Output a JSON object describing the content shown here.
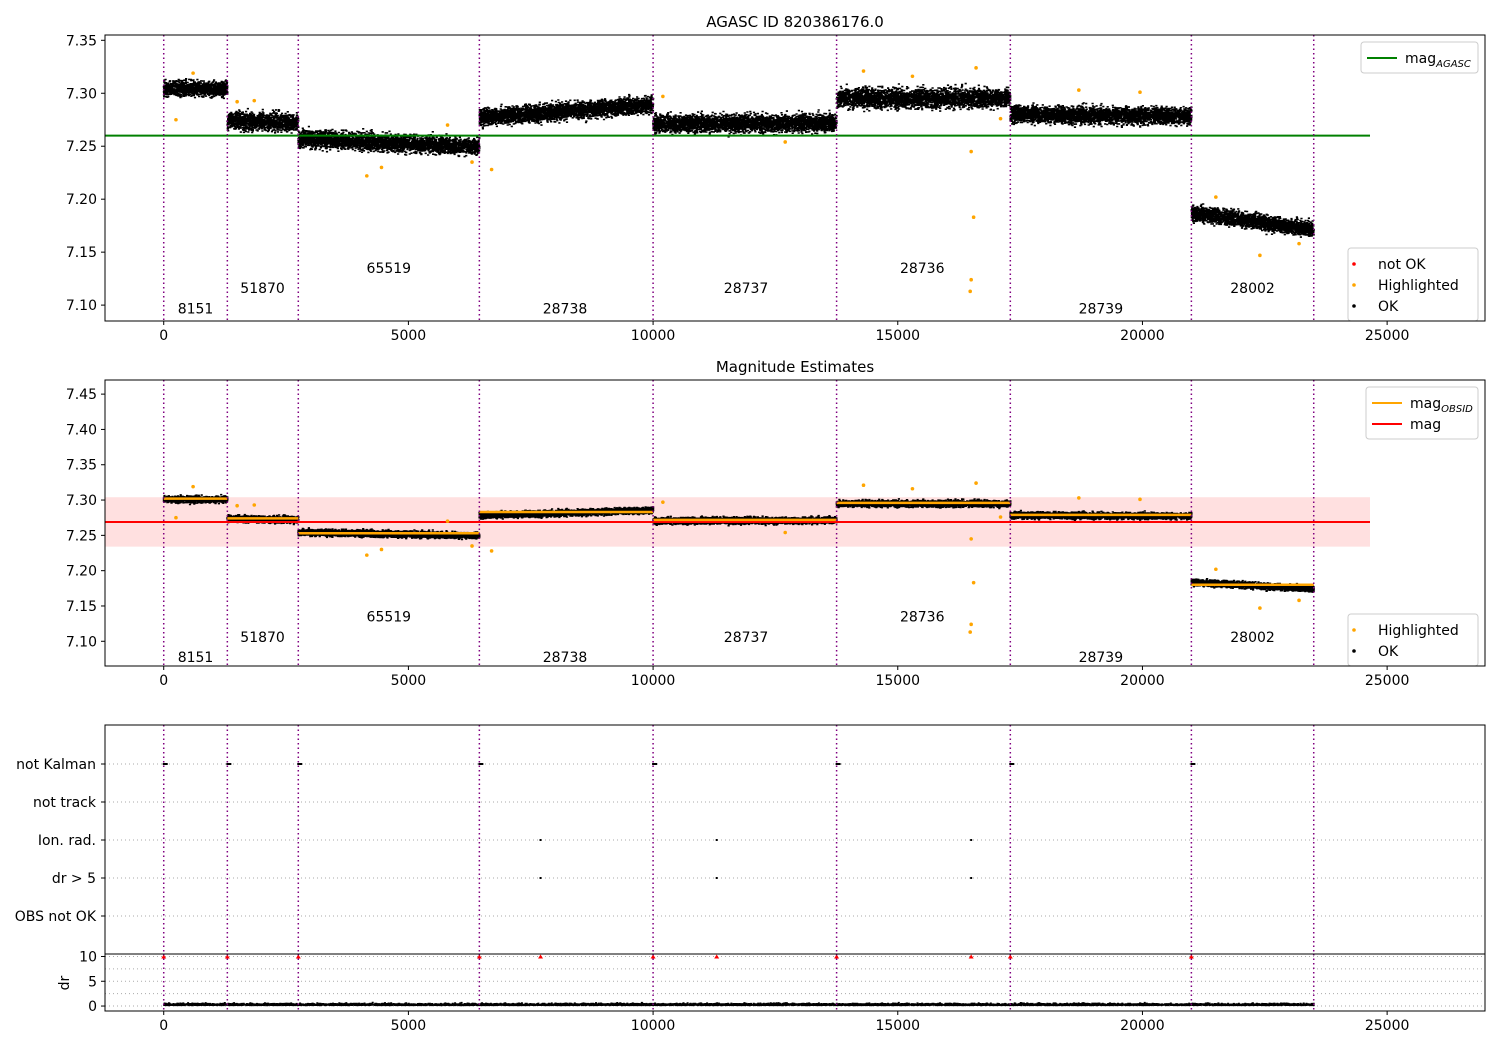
{
  "chart_data": [
    {
      "type": "scatter",
      "title": "AGASC ID 820386176.0",
      "xlabel": "",
      "ylabel": "",
      "xlim": [
        -1200,
        27000
      ],
      "ylim": [
        7.085,
        7.355
      ],
      "xticks": [
        "0",
        "5000",
        "10000",
        "15000",
        "20000",
        "25000"
      ],
      "yticks": [
        "7.10",
        "7.15",
        "7.20",
        "7.25",
        "7.30",
        "7.35"
      ],
      "obs_boundaries": [
        0,
        1300,
        2750,
        6450,
        10000,
        13750,
        17300,
        21000,
        23500
      ],
      "obs_labels": [
        {
          "text": "8151",
          "x": 650,
          "y": 7.097
        },
        {
          "text": "51870",
          "x": 2020,
          "y": 7.116
        },
        {
          "text": "65519",
          "x": 4600,
          "y": 7.135
        },
        {
          "text": "28738",
          "x": 8200,
          "y": 7.097
        },
        {
          "text": "28737",
          "x": 11900,
          "y": 7.116
        },
        {
          "text": "28736",
          "x": 15500,
          "y": 7.135
        },
        {
          "text": "28739",
          "x": 19150,
          "y": 7.097
        },
        {
          "text": "28002",
          "x": 22250,
          "y": 7.116
        }
      ],
      "segments": [
        {
          "obsid": "8151",
          "x0": 0,
          "x1": 1300,
          "y_start": 7.305,
          "y_end": 7.305,
          "spread": 0.007
        },
        {
          "obsid": "51870",
          "x0": 1300,
          "x1": 2750,
          "y_start": 7.275,
          "y_end": 7.273,
          "spread": 0.008
        },
        {
          "obsid": "65519",
          "x0": 2750,
          "x1": 6450,
          "y_start": 7.258,
          "y_end": 7.25,
          "spread": 0.008
        },
        {
          "obsid": "28738",
          "x0": 6450,
          "x1": 10000,
          "y_start": 7.278,
          "y_end": 7.29,
          "spread": 0.008
        },
        {
          "obsid": "28737",
          "x0": 10000,
          "x1": 13750,
          "y_start": 7.272,
          "y_end": 7.273,
          "spread": 0.008
        },
        {
          "obsid": "28736",
          "x0": 13750,
          "x1": 17300,
          "y_start": 7.296,
          "y_end": 7.296,
          "spread": 0.009
        },
        {
          "obsid": "28739",
          "x0": 17300,
          "x1": 21000,
          "y_start": 7.281,
          "y_end": 7.279,
          "spread": 0.008
        },
        {
          "obsid": "28002",
          "x0": 21000,
          "x1": 23500,
          "y_start": 7.188,
          "y_end": 7.172,
          "spread": 0.007
        }
      ],
      "highlighted_outliers": [
        [
          250,
          7.275
        ],
        [
          600,
          7.319
        ],
        [
          1500,
          7.292
        ],
        [
          1850,
          7.293
        ],
        [
          4150,
          7.222
        ],
        [
          4450,
          7.23
        ],
        [
          5800,
          7.27
        ],
        [
          6300,
          7.235
        ],
        [
          6700,
          7.228
        ],
        [
          10200,
          7.297
        ],
        [
          12700,
          7.254
        ],
        [
          14300,
          7.321
        ],
        [
          15300,
          7.316
        ],
        [
          16500,
          7.245
        ],
        [
          16550,
          7.183
        ],
        [
          16500,
          7.124
        ],
        [
          16480,
          7.113
        ],
        [
          16600,
          7.324
        ],
        [
          17100,
          7.276
        ],
        [
          18700,
          7.303
        ],
        [
          19950,
          7.301
        ],
        [
          21500,
          7.202
        ],
        [
          22400,
          7.147
        ],
        [
          23200,
          7.158
        ]
      ],
      "reference_lines": [
        {
          "name": "mag_AGASC",
          "y": 7.26,
          "x0": -1200,
          "x1": 24650,
          "color": "#008000"
        }
      ],
      "legend": {
        "position": "top-right",
        "entries": [
          {
            "label": "mag",
            "sub": "AGASC",
            "color": "#008000",
            "kind": "line"
          }
        ]
      },
      "legend2": {
        "position": "bottom-right",
        "entries": [
          {
            "label": "not OK",
            "color": "#ff0000",
            "kind": "dot"
          },
          {
            "label": "Highlighted",
            "color": "#ffa500",
            "kind": "dot"
          },
          {
            "label": "OK",
            "color": "#000000",
            "kind": "dot"
          }
        ]
      },
      "grid": false
    },
    {
      "type": "scatter",
      "title": "Magnitude Estimates",
      "xlabel": "",
      "ylabel": "",
      "xlim": [
        -1200,
        27000
      ],
      "ylim": [
        7.065,
        7.47
      ],
      "xticks": [
        "0",
        "5000",
        "10000",
        "15000",
        "20000",
        "25000"
      ],
      "yticks": [
        "7.10",
        "7.15",
        "7.20",
        "7.25",
        "7.30",
        "7.35",
        "7.40",
        "7.45"
      ],
      "obs_boundaries": [
        0,
        1300,
        2750,
        6450,
        10000,
        13750,
        17300,
        21000,
        23500
      ],
      "obs_labels": [
        {
          "text": "8151",
          "x": 650,
          "y": 7.078
        },
        {
          "text": "51870",
          "x": 2020,
          "y": 7.106
        },
        {
          "text": "65519",
          "x": 4600,
          "y": 7.135
        },
        {
          "text": "28738",
          "x": 8200,
          "y": 7.078
        },
        {
          "text": "28737",
          "x": 11900,
          "y": 7.106
        },
        {
          "text": "28736",
          "x": 15500,
          "y": 7.135
        },
        {
          "text": "28739",
          "x": 19150,
          "y": 7.078
        },
        {
          "text": "28002",
          "x": 22250,
          "y": 7.106
        }
      ],
      "obs_means": [
        7.302,
        7.274,
        7.253,
        7.283,
        7.272,
        7.296,
        7.279,
        7.18
      ],
      "overall_mag": 7.269,
      "mag_band": [
        7.234,
        7.304
      ],
      "legend": {
        "position": "top-right",
        "entries": [
          {
            "label": "mag",
            "sub": "OBSID",
            "color": "#ffa500",
            "kind": "line"
          },
          {
            "label": "mag",
            "sub": "",
            "color": "#ff0000",
            "kind": "line"
          }
        ]
      },
      "legend2": {
        "position": "bottom-right",
        "entries": [
          {
            "label": "Highlighted",
            "color": "#ffa500",
            "kind": "dot"
          },
          {
            "label": "OK",
            "color": "#000000",
            "kind": "dot"
          }
        ]
      },
      "grid": false
    },
    {
      "type": "scatter",
      "title": "",
      "xlabel": "",
      "ylabel": "",
      "xlim": [
        -1200,
        27000
      ],
      "flag_rows": [
        "not Kalman",
        "not track",
        "Ion. rad.",
        "dr > 5",
        "OBS not OK"
      ],
      "flag_points": {
        "not Kalman": [
          0,
          1300,
          2750,
          6450,
          10000,
          13750,
          17300,
          21000
        ],
        "not track": [],
        "Ion. rad.": [
          7700,
          11300,
          16500
        ],
        "dr > 5": [
          7700,
          11300,
          16500
        ],
        "OBS not OK": []
      },
      "grid": true
    },
    {
      "type": "scatter",
      "title": "",
      "xlabel": "",
      "ylabel": "dr",
      "xlim": [
        -1200,
        27000
      ],
      "ylim": [
        -1,
        10.5
      ],
      "xticks": [
        "0",
        "5000",
        "10000",
        "15000",
        "20000",
        "25000"
      ],
      "yticks": [
        "0",
        "5",
        "10"
      ],
      "dr_high_points": [
        0,
        1300,
        2750,
        6450,
        7700,
        10000,
        11300,
        13750,
        16500,
        17300,
        21000
      ],
      "dr_high_value": 10,
      "dr_base": 0.3,
      "grid": true
    }
  ]
}
